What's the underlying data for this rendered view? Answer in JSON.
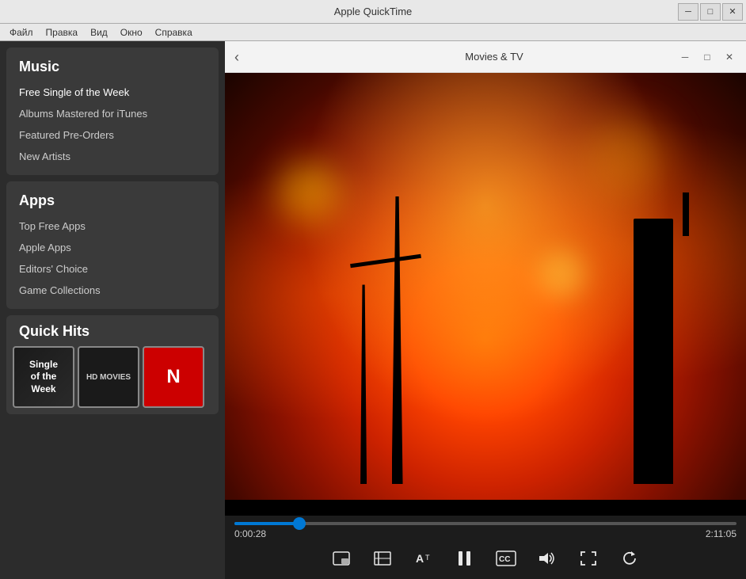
{
  "window": {
    "title": "Apple QuickTime",
    "min_btn": "─",
    "max_btn": "□",
    "close_btn": "✕"
  },
  "menubar": {
    "items": [
      "Файл",
      "Правка",
      "Вид",
      "Окно",
      "Справка"
    ]
  },
  "sidebar": {
    "music_section": {
      "title": "Music",
      "items": [
        "Free Single of the Week",
        "Albums Mastered for iTunes",
        "Featured Pre-Orders",
        "New Artists"
      ]
    },
    "apps_section": {
      "title": "Apps",
      "items": [
        "Top Free Apps",
        "Apple Apps",
        "Editors' Choice",
        "Game Collections"
      ]
    },
    "quick_hits": {
      "title": "Quick Hits",
      "item1_line1": "Single",
      "item1_line2": "of the Week",
      "item2_label": "HD MOVIES",
      "item3_label": "N"
    }
  },
  "movies_tv": {
    "title": "Movies & TV",
    "back_btn": "‹",
    "min_btn": "─",
    "max_btn": "□",
    "close_btn": "✕"
  },
  "player": {
    "current_time": "0:00:28",
    "total_time": "2:11:05",
    "progress_pct": 13,
    "controls": {
      "picture_in_picture": "⬜",
      "chapters": "⊟",
      "captions_size": "Aᵀ",
      "play_pause": "⏸",
      "closed_captions": "CC",
      "volume": "🔊",
      "fullscreen": "⛶",
      "replay": "↻"
    }
  }
}
